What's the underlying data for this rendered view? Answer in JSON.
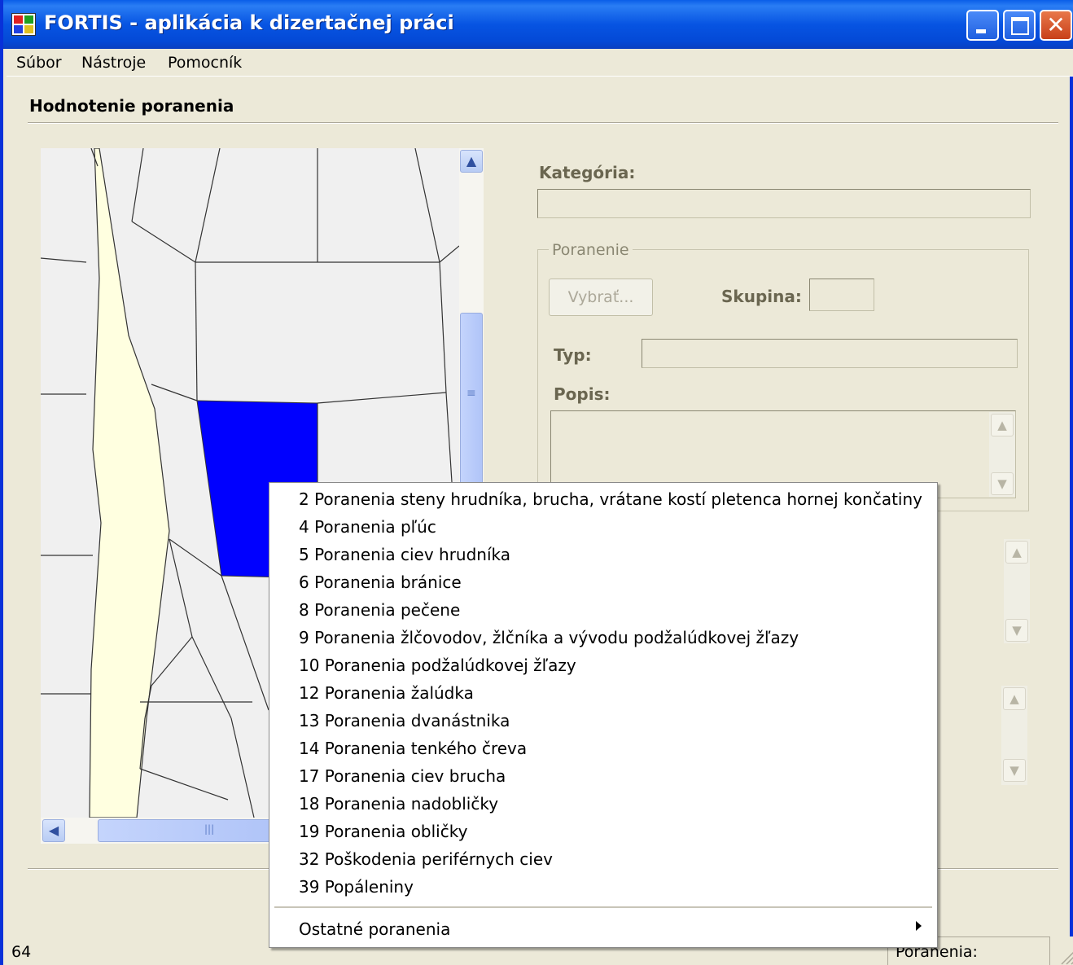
{
  "window": {
    "title": "FORTIS - aplikácia k dizertačnej práci",
    "close_glyph": "✕"
  },
  "menubar": {
    "items": [
      "Súbor",
      "Nástroje",
      "Pomocník"
    ]
  },
  "section": {
    "title": "Hodnotenie poranenia"
  },
  "body_map": {
    "selected_color": "#0000ff",
    "limb_color": "#ffffe0"
  },
  "scroll": {
    "up": "▲",
    "down": "▼",
    "left": "◀",
    "grip_v": "≡",
    "grip_h": "|||"
  },
  "form": {
    "category_label": "Kategória:",
    "category_value": "",
    "group_legend": "Poranenie",
    "select_button": "Vybrať...",
    "group_label": "Skupina:",
    "group_value": "",
    "type_label": "Typ:",
    "type_value": "",
    "description_label": "Popis:",
    "description_value": ""
  },
  "context_menu": {
    "items": [
      "2 Poranenia steny hrudníka, brucha, vrátane kostí pletenca hornej končatiny",
      "4 Poranenia pľúc",
      "5 Poranenia ciev hrudníka",
      "6 Poranenia bránice",
      "8 Poranenia pečene",
      "9 Poranenia žlčovodov, žlčníka a vývodu podžalúdkovej žľazy",
      "10 Poranenia podžalúdkovej žľazy",
      "12 Poranenia žalúdka",
      "13 Poranenia dvanástnika",
      "14 Poranenia tenkého čreva",
      "17 Poranenia ciev brucha",
      "18 Poranenia nadobličky",
      "19 Poranenia obličky",
      "32 Poškodenia periférnych ciev",
      "39 Popáleniny"
    ],
    "submenu": "Ostatné poranenia"
  },
  "status": {
    "left": "64",
    "right": "Poranenia:"
  }
}
